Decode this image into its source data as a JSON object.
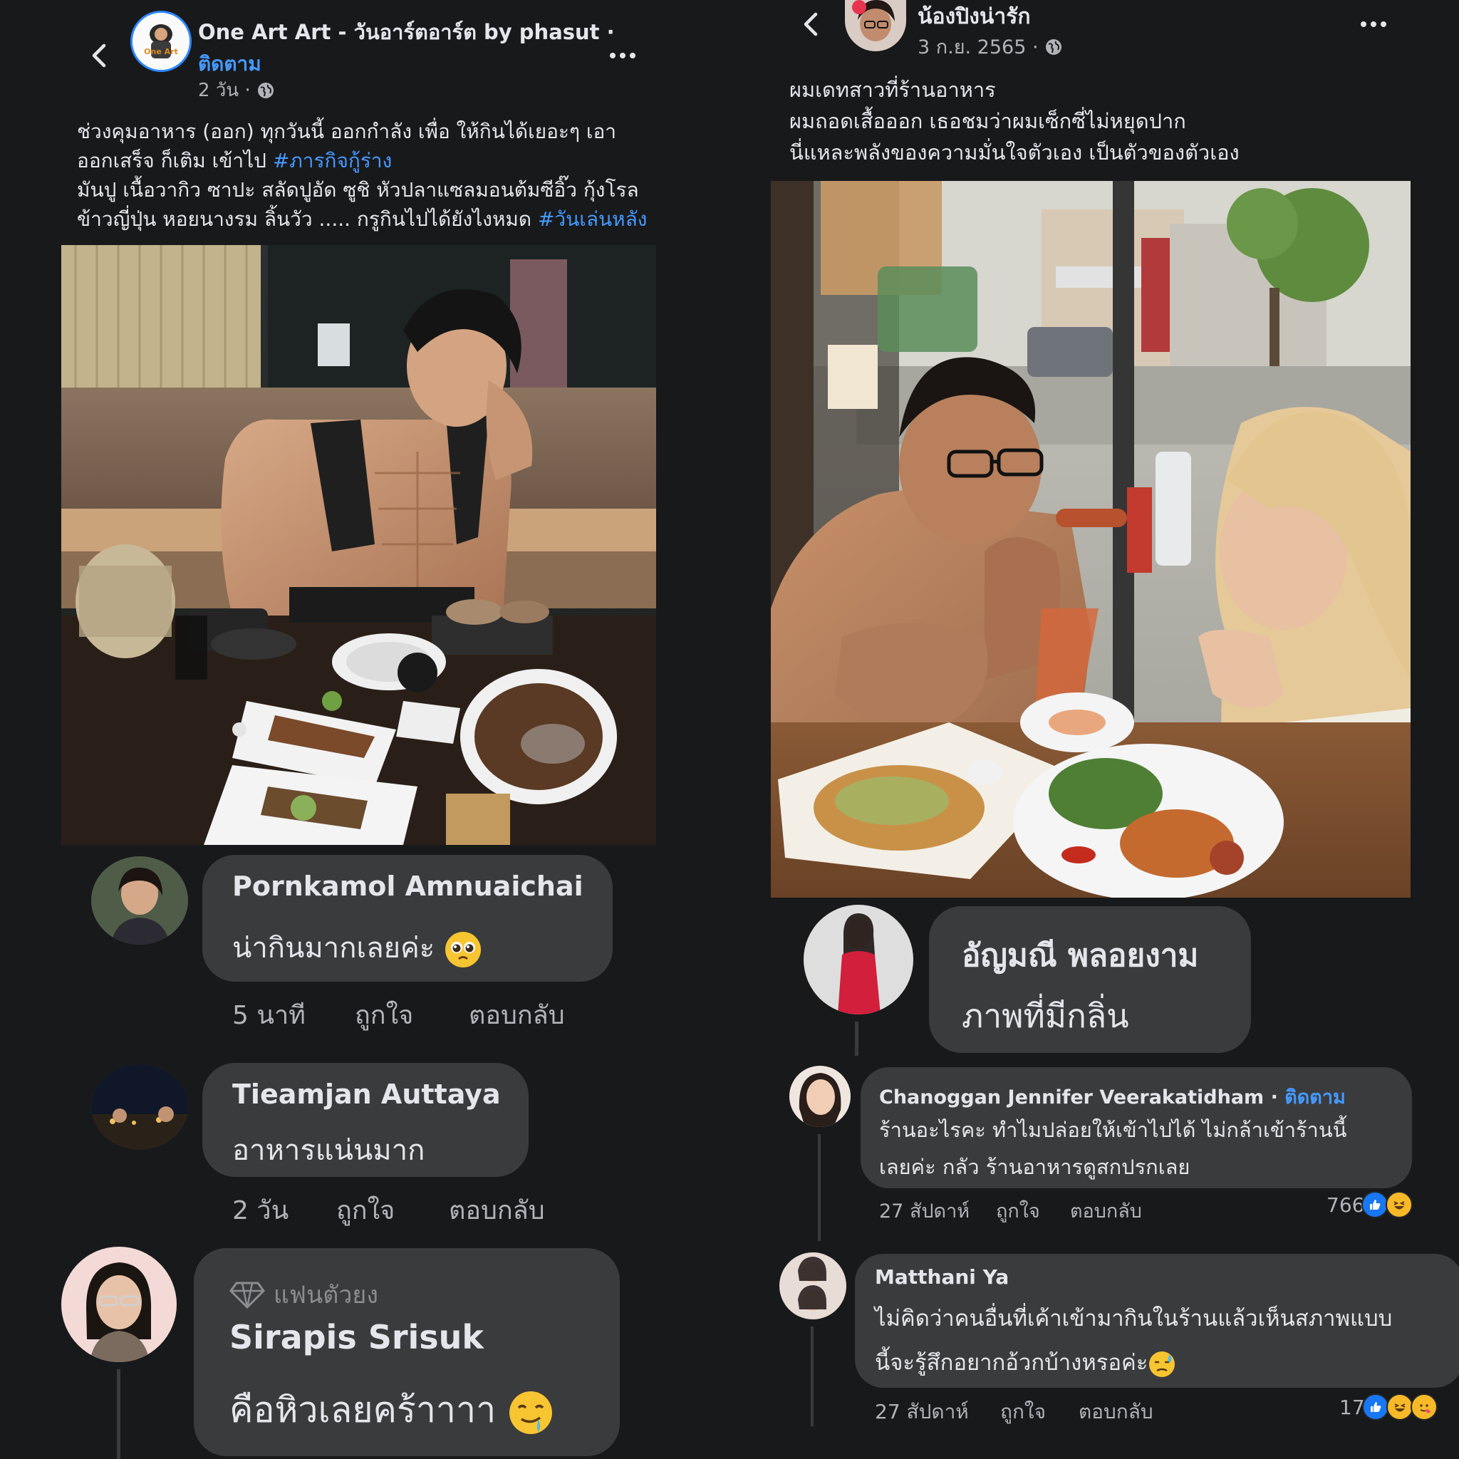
{
  "left_post": {
    "page_name": "One Art Art - วันอาร์ตอาร์ต by phasut ·",
    "follow_label": "ติดตาม",
    "time": "2 วัน ·",
    "caption_line1_a": "ช่วงคุมอาหาร (ออก) ทุกวันนี้ ออกกำลัง เพื่อ ให้กินได้เยอะๆ เอา",
    "caption_line2_a": "ออกเสร็จ ก็เติม เข้าไป ",
    "caption_line2_tag": "#ภารกิจกู้ร่าง",
    "caption_line3": "มันปู เนื้อวากิว ซาปะ สลัดปูอัด ซูชิ หัวปลาแซลมอนต้มซีอิ๊ว กุ้งโรล",
    "caption_line4_a": "ข้าวญี่ปุ่น หอยนางรม ลิ้นวัว ..... กรูกินไปได้ยังไงหมด ",
    "caption_line4_tag": "#วันเล่นหลัง",
    "avatar_logo_text": "One Art",
    "comments": [
      {
        "name": "Pornkamol Amnuaichai",
        "text": "น่ากินมากเลยค่ะ",
        "time": "5 นาที",
        "like": "ถูกใจ",
        "reply": "ตอบกลับ"
      },
      {
        "name": "Tieamjan Auttaya",
        "text": "อาหารแน่นมาก",
        "time": "2 วัน",
        "like": "ถูกใจ",
        "reply": "ตอบกลับ"
      },
      {
        "badge": "แฟนตัวยง",
        "name": "Sirapis Srisuk",
        "text": "คือหิวเลยคร้าาาา"
      }
    ]
  },
  "right_post": {
    "page_name": "น้องปิงน่ารัก",
    "time": "3 ก.ย. 2565 ·",
    "caption_line1": "ผมเดทสาวที่ร้านอาหาร",
    "caption_line2": "ผมถอดเสื้อออก เธอชมว่าผมเซ็กซี่ไม่หยุดปาก",
    "caption_line3": "นี่แหละพลังของความมั่นใจตัวเอง เป็นตัวของตัวเอง",
    "comments": [
      {
        "name": "อัญมณี พลอยงาม",
        "text": "ภาพที่มีกลิ่น"
      },
      {
        "name": "Chanoggan Jennifer Veerakatidham ·",
        "follow": "ติดตาม",
        "text1": "ร้านอะไรคะ ทำไมปล่อยให้เข้าไปได้ ไม่กล้าเข้าร้านนี้",
        "text2": "เลยค่ะ กลัว ร้านอาหารดูสกปรกเลย",
        "time": "27 สัปดาห์",
        "like": "ถูกใจ",
        "reply": "ตอบกลับ",
        "reactions": "766"
      },
      {
        "name": "Matthani Ya",
        "text1": "ไม่คิดว่าคนอื่นที่เค้าเข้ามากินในร้านแล้วเห็นสภาพแบบ",
        "text2": "นี้จะรู้สึกอยากอ้วกบ้างหรอค่ะ",
        "time": "27 สัปดาห์",
        "like": "ถูกใจ",
        "reply": "ตอบกลับ",
        "reactions": "17"
      }
    ]
  },
  "colors": {
    "background": "#18191b",
    "bubble": "#3a3b3c",
    "link": "#4599ff",
    "secondary_text": "#b0b3b8",
    "like_blue": "#1877f2",
    "haha_yellow": "#f7b928"
  },
  "icons": [
    "back-chevron-icon",
    "more-dots-icon",
    "globe-icon",
    "diamond-badge-icon",
    "like-reaction-icon",
    "haha-reaction-icon",
    "care-reaction-icon",
    "pleading-face-emoji",
    "drooling-face-emoji",
    "sweat-face-emoji"
  ]
}
